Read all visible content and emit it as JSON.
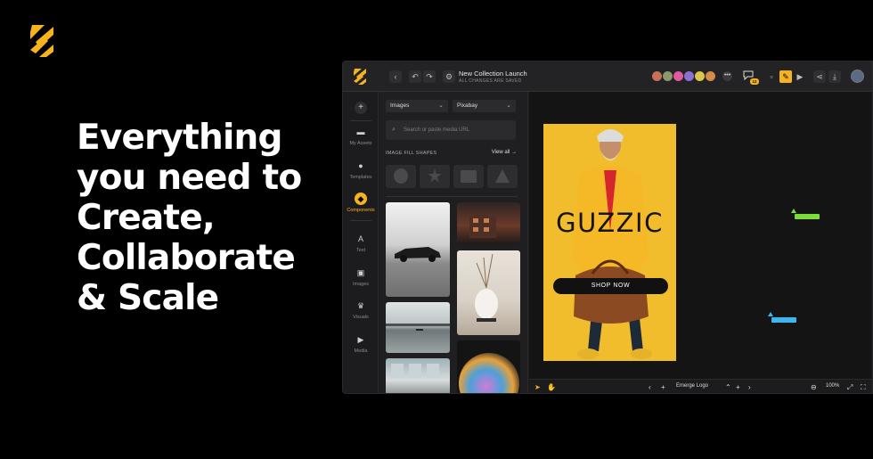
{
  "headline": [
    "Everything",
    "you need to",
    "Create,",
    "Collaborate",
    "& Scale"
  ],
  "colors": {
    "accent": "#f6b31d",
    "background": "#000000",
    "app_bg": "#1c1c1e"
  },
  "app": {
    "document_title": "New Collection Launch",
    "document_status": "ALL CHANGES ARE SAVED",
    "comment_count": "12",
    "toolbar_icons": [
      "back-icon",
      "undo-icon",
      "redo-icon",
      "settings-icon",
      "pen-icon",
      "play-icon",
      "share-icon",
      "download-icon"
    ]
  },
  "rail": {
    "items": [
      {
        "label": "",
        "icon": "+"
      },
      {
        "label": "My Assets",
        "icon": "folder-icon"
      },
      {
        "label": "Templates",
        "icon": "templates-icon"
      },
      {
        "label": "Components",
        "icon": "components-icon"
      },
      {
        "label": "Text",
        "icon": "A"
      },
      {
        "label": "Images",
        "icon": "image-icon"
      },
      {
        "label": "Visuals",
        "icon": "crown-icon"
      },
      {
        "label": "Media",
        "icon": "play-icon"
      }
    ]
  },
  "panel": {
    "type_select": "Images",
    "source_select": "Pixabay",
    "search_placeholder": "Search or paste media URL",
    "section_title": "IMAGE FILL SHAPES",
    "view_all": "View all"
  },
  "canvas": {
    "poster_brand": "GUZZIC",
    "poster_button": "SHOP NOW"
  },
  "bottombar": {
    "layer_name": "Emerge Logo",
    "zoom": "100%"
  }
}
